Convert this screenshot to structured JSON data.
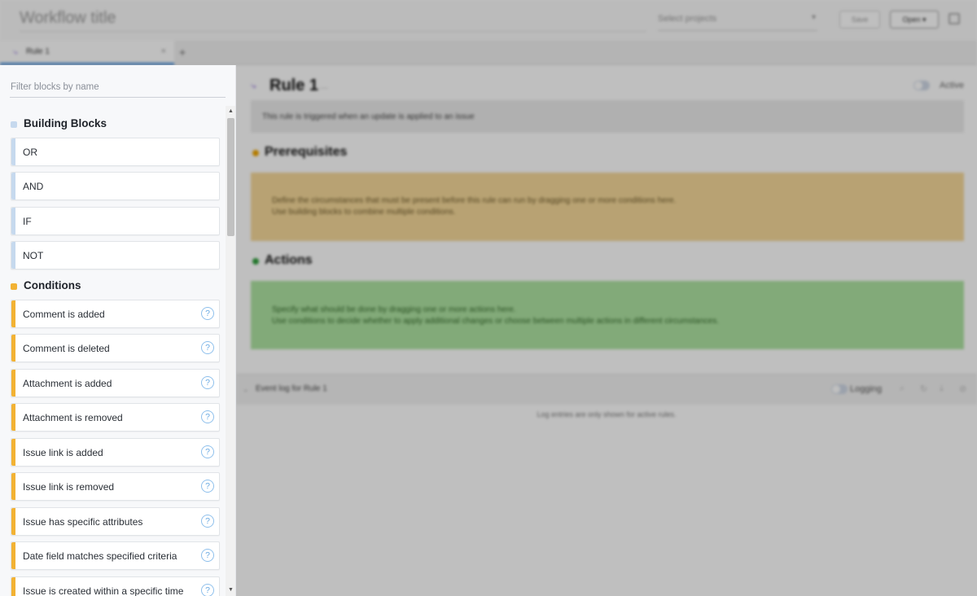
{
  "topbar": {
    "workflow_title": "Workflow title",
    "project_select_placeholder": "Select projects",
    "save_label": "Save",
    "open_label": "Open ▾"
  },
  "tabs": [
    {
      "label": "Rule 1",
      "close_glyph": "×"
    }
  ],
  "tab_add_glyph": "+",
  "rule": {
    "title": "Rule 1",
    "more_glyph": "...",
    "active_label": "Active",
    "trigger_text": "This rule is triggered when an update is applied to an issue",
    "prerequisites": {
      "title": "Prerequisites",
      "line1": "Define the circumstances that must be present before this rule can run by dragging one or more conditions here.",
      "line2": "Use building blocks to combine multiple conditions.",
      "color": "#f0a500"
    },
    "actions": {
      "title": "Actions",
      "line1": "Specify what should be done by dragging one or more actions here.",
      "line2": "Use conditions to decide whether to apply additional changes or choose between multiple actions in different circumstances.",
      "color": "#2e9e3a"
    }
  },
  "event_log": {
    "title": "Event log for Rule 1",
    "logging_label": "Logging",
    "empty_text": "Log entries are only shown for active rules."
  },
  "sidebar": {
    "filter_placeholder": "Filter blocks by name",
    "groups": [
      {
        "title": "Building Blocks",
        "color": "#c6d9ee",
        "items": [
          {
            "label": "OR"
          },
          {
            "label": "AND"
          },
          {
            "label": "IF"
          },
          {
            "label": "NOT"
          }
        ]
      },
      {
        "title": "Conditions",
        "color": "#f2b233",
        "items": [
          {
            "label": "Comment is added"
          },
          {
            "label": "Comment is deleted"
          },
          {
            "label": "Attachment is added"
          },
          {
            "label": "Attachment is removed"
          },
          {
            "label": "Issue link is added"
          },
          {
            "label": "Issue link is removed"
          },
          {
            "label": "Issue has specific attributes"
          },
          {
            "label": "Date field matches specified criteria"
          },
          {
            "label": "Issue is created within a specific time"
          }
        ]
      }
    ],
    "help_glyph": "?"
  },
  "icons": {
    "rule_icon": "⤷",
    "collapse_icon": "⌄",
    "scroll_up": "▲",
    "scroll_down": "▼"
  }
}
